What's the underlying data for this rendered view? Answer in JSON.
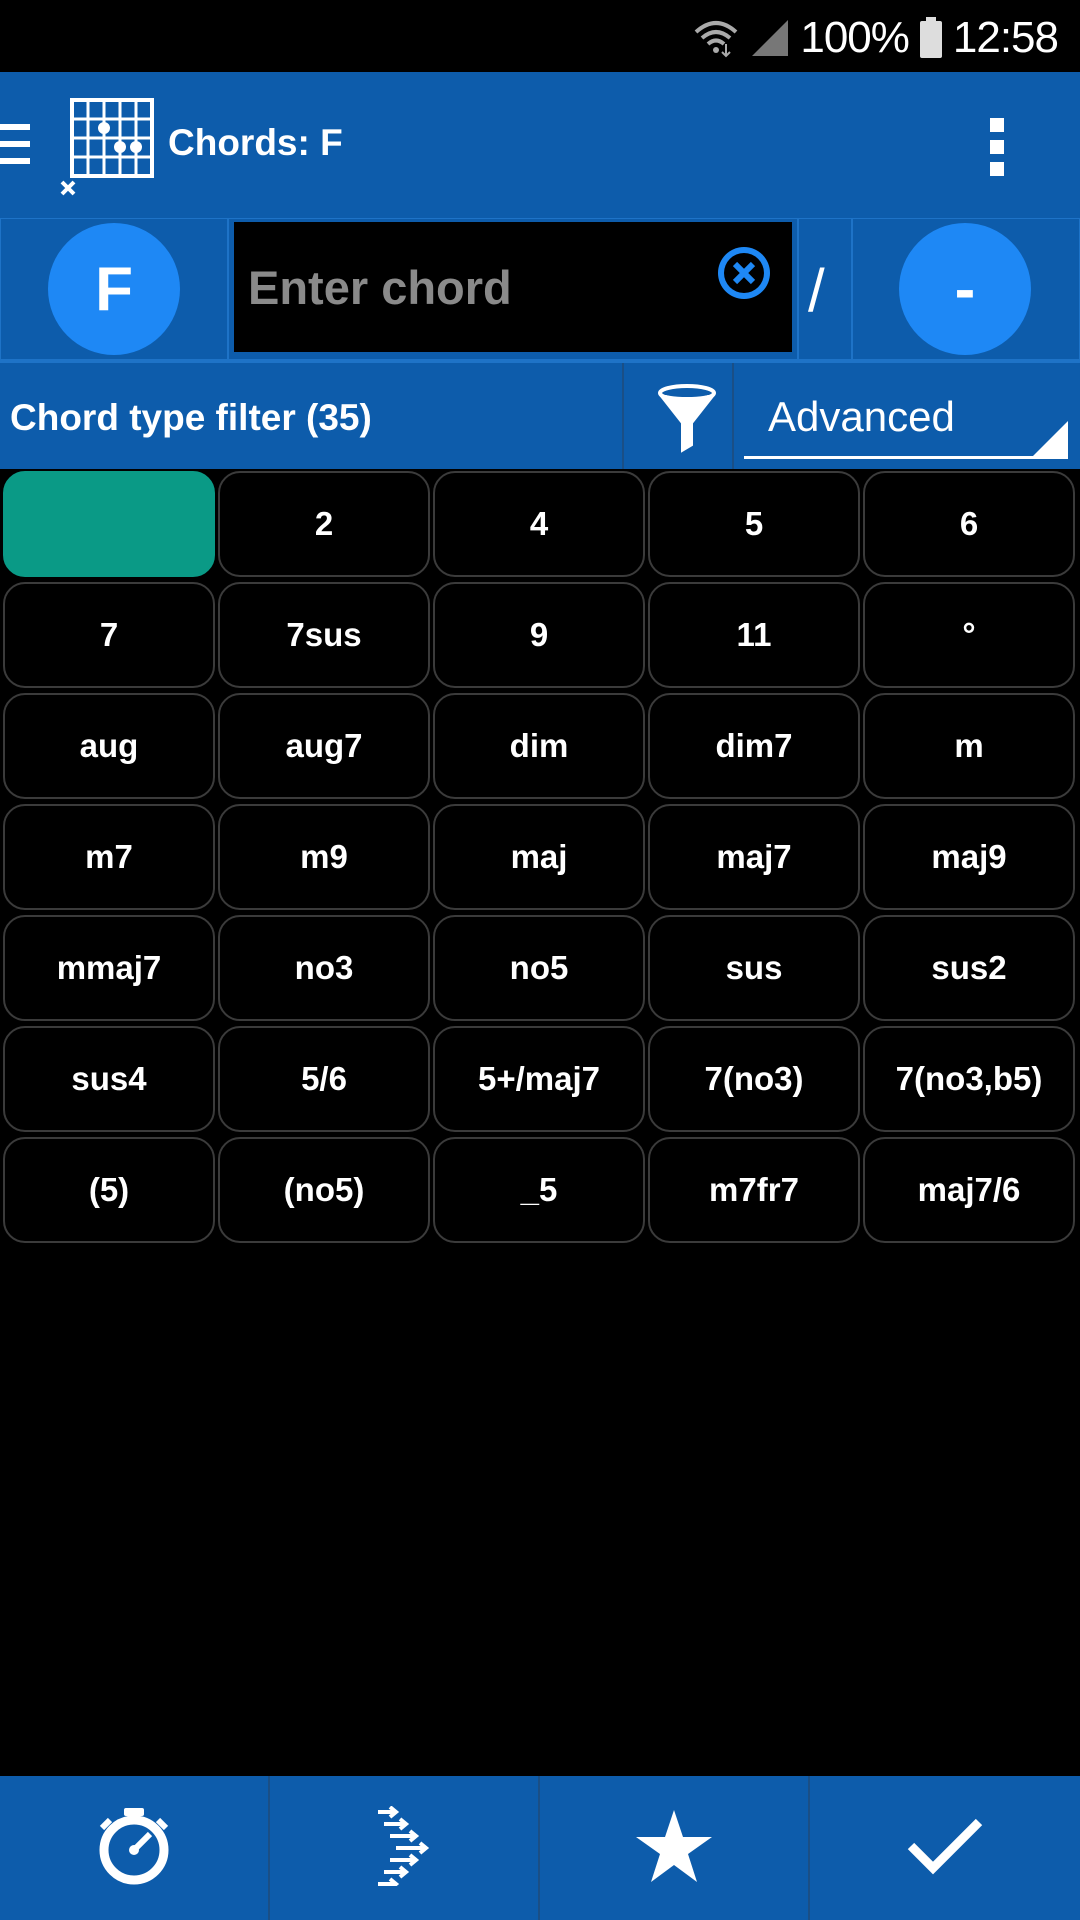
{
  "status_bar": {
    "battery": "100%",
    "time": "12:58",
    "icons": [
      "wifi-icon",
      "cell-signal-icon",
      "battery-icon"
    ]
  },
  "app_bar": {
    "title": "Chords: F",
    "menu_icon": "hamburger-icon",
    "logo_icon": "chord-diagram-icon",
    "overflow_icon": "more-vert-icon"
  },
  "input_row": {
    "root_note": "F",
    "chord_placeholder": "Enter chord",
    "chord_value": "",
    "clear_icon": "clear-circle-icon",
    "slash": "/",
    "bass_note": "-"
  },
  "filter_row": {
    "label": "Chord type filter (35)",
    "filter_icon": "funnel-icon",
    "mode": "Advanced"
  },
  "chord_types": [
    {
      "label": "",
      "selected": true
    },
    {
      "label": "2"
    },
    {
      "label": "4"
    },
    {
      "label": "5"
    },
    {
      "label": "6"
    },
    {
      "label": "7"
    },
    {
      "label": "7sus"
    },
    {
      "label": "9"
    },
    {
      "label": "11"
    },
    {
      "label": "°"
    },
    {
      "label": "aug"
    },
    {
      "label": "aug7"
    },
    {
      "label": "dim"
    },
    {
      "label": "dim7"
    },
    {
      "label": "m"
    },
    {
      "label": "m7"
    },
    {
      "label": "m9"
    },
    {
      "label": "maj"
    },
    {
      "label": "maj7"
    },
    {
      "label": "maj9"
    },
    {
      "label": "mmaj7"
    },
    {
      "label": "no3"
    },
    {
      "label": "no5"
    },
    {
      "label": "sus"
    },
    {
      "label": "sus2"
    },
    {
      "label": "sus4"
    },
    {
      "label": "5/6"
    },
    {
      "label": "5+/maj7"
    },
    {
      "label": "7(no3)"
    },
    {
      "label": "7(no3,b5)"
    },
    {
      "label": "(5)"
    },
    {
      "label": "(no5)"
    },
    {
      "label": "_5"
    },
    {
      "label": "m7fr7"
    },
    {
      "label": "maj7/6"
    }
  ],
  "bottom_bar": {
    "buttons": [
      {
        "icon": "metronome-timer-icon"
      },
      {
        "icon": "arpeggio-arrows-icon"
      },
      {
        "icon": "star-icon"
      },
      {
        "icon": "checkmark-icon"
      }
    ]
  },
  "colors": {
    "primary": "#0d5cab",
    "accent_circle": "#1e88f5",
    "selected_chip": "#0a9a86",
    "background": "#000000"
  }
}
